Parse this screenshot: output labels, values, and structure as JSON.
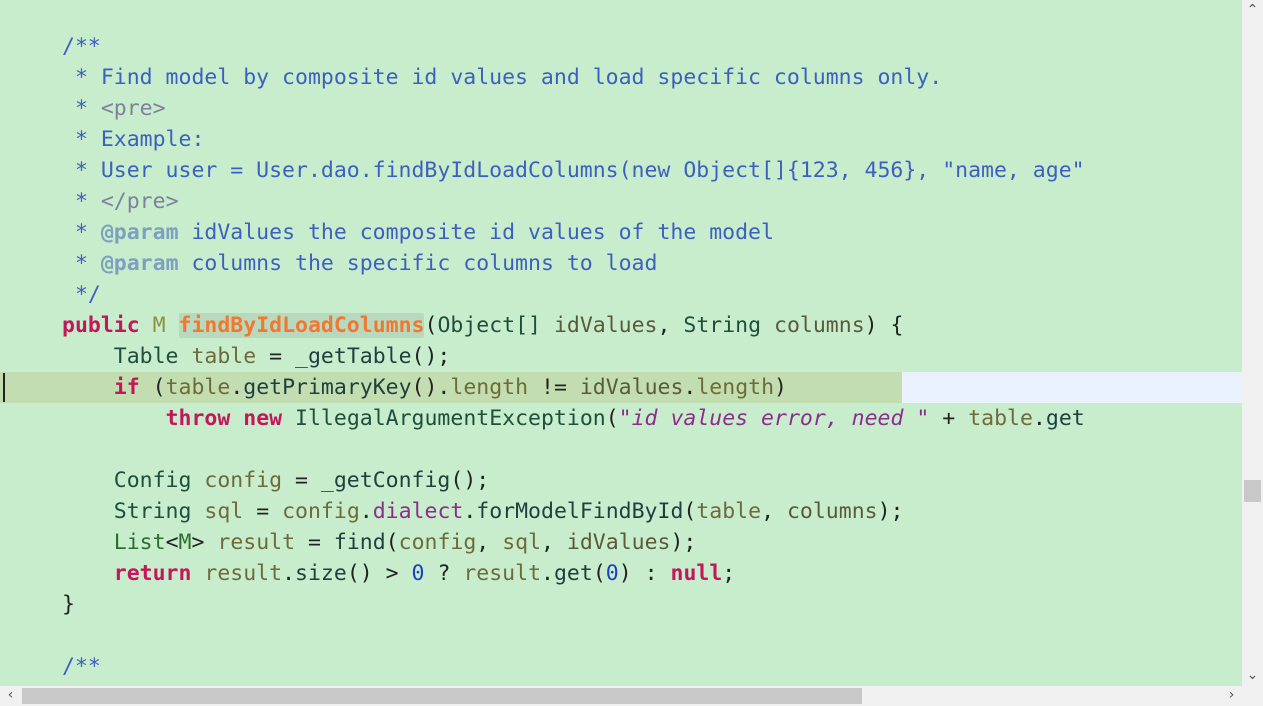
{
  "editor": {
    "lines": {
      "l01": {
        "a": "/**"
      },
      "l02": {
        "a": " * Find model by composite id values and load specific columns only."
      },
      "l03": {
        "a": " * ",
        "b": "<pre>"
      },
      "l04": {
        "a": " * Example:"
      },
      "l05": {
        "a": " * User user = User.dao.findByIdLoadColumns(new Object[]{123, 456}, \"name, age\""
      },
      "l06": {
        "a": " * ",
        "b": "</pre>"
      },
      "l07": {
        "a": " * ",
        "b": "@param",
        "c": " idValues the composite id values of the model"
      },
      "l08": {
        "a": " * ",
        "b": "@param",
        "c": " columns the specific columns to load"
      },
      "l09": {
        "a": " */"
      },
      "l10": {
        "kw": "public",
        "sp1": " ",
        "tp": "M",
        "sp2": " ",
        "name": "findByIdLoadColumns",
        "p1": "(",
        "t1": "Object[]",
        "sp3": " ",
        "a1": "idValues",
        "p2": ", ",
        "t2": "String",
        "sp4": " ",
        "a2": "columns",
        "p3": ") {"
      },
      "l11": {
        "ind": "    ",
        "t": "Table",
        "sp": " ",
        "v": "table",
        "op": " = ",
        "m": "_getTable",
        "end": "();"
      },
      "l12": {
        "ind": "    ",
        "kw": "if",
        "sp": " ",
        "p1": "(",
        "v": "table",
        "dot1": ".",
        "m": "getPrimaryKey",
        "p2": "().",
        "f1": "length",
        "op": " != ",
        "a": "idValues",
        "dot2": ".",
        "f2": "length",
        "p3": ")"
      },
      "l13": {
        "ind": "        ",
        "kw1": "throw",
        "sp1": " ",
        "kw2": "new",
        "sp2": " ",
        "t": "IllegalArgumentException",
        "p1": "(",
        "s": "\"id values error, need \"",
        "op": " + ",
        "v": "table",
        "dot": ".",
        "m": "get"
      },
      "l14": {},
      "l15": {
        "ind": "    ",
        "t": "Config",
        "sp": " ",
        "v": "config",
        "op": " = ",
        "m": "_getConfig",
        "end": "();"
      },
      "l16": {
        "ind": "    ",
        "t": "String",
        "sp": " ",
        "v": "sql",
        "op": " = ",
        "v2": "config",
        "dot1": ".",
        "f": "dialect",
        "dot2": ".",
        "m": "forModelFindById",
        "p1": "(",
        "v3": "table",
        "p2": ", ",
        "a": "columns",
        "end": ");"
      },
      "l17": {
        "ind": "    ",
        "t": "List",
        "lt": "<",
        "tp": "M",
        "gt": ">",
        "sp": " ",
        "v": "result",
        "op": " = ",
        "m": "find",
        "p1": "(",
        "v2": "config",
        "p2": ", ",
        "v3": "sql",
        "p3": ", ",
        "a": "idValues",
        "end": ");"
      },
      "l18": {
        "ind": "    ",
        "kw": "return",
        "sp": " ",
        "v": "result",
        "dot1": ".",
        "m": "size",
        "p1": "()",
        "op1": " > ",
        "n1": "0",
        "op2": " ? ",
        "v2": "result",
        "dot2": ".",
        "m2": "get",
        "p2": "(",
        "n2": "0",
        "p3": ")",
        "op3": " : ",
        "kw2": "null",
        "end": ";"
      },
      "l19": {
        "a": "}"
      },
      "l20": {},
      "l21": {
        "a": "/**"
      }
    }
  },
  "scrollbars": {
    "up_arrow": "⌃",
    "down_arrow": "⌄",
    "left_arrow": "‹",
    "right_arrow": "›"
  }
}
